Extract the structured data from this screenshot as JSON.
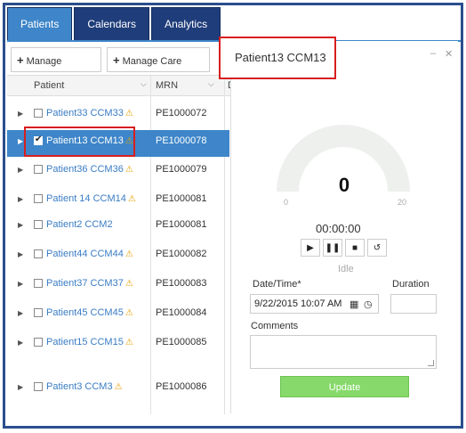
{
  "tabs": [
    {
      "label": "Patients",
      "active": true
    },
    {
      "label": "Calendars",
      "active": false
    },
    {
      "label": "Analytics",
      "active": false
    }
  ],
  "toolbar": {
    "manage_patients_label": "Manage Patients",
    "manage_care_team_label": "Manage Care Team"
  },
  "grid": {
    "headers": {
      "patient": "Patient",
      "mrn": "MRN",
      "third": "D"
    },
    "rows": [
      {
        "name": "Patient33 CCM33",
        "mrn": "PE1000072",
        "warn": true,
        "selected": false
      },
      {
        "name": "Patient13 CCM13",
        "mrn": "PE1000078",
        "warn": true,
        "selected": true
      },
      {
        "name": "Patient36 CCM36",
        "mrn": "PE1000079",
        "warn": true,
        "selected": false
      },
      {
        "name": "Patient 14 CCM14",
        "mrn": "PE1000081",
        "warn": true,
        "selected": false
      },
      {
        "name": "Patient2 CCM2",
        "mrn": "PE1000081",
        "warn": false,
        "selected": false
      },
      {
        "name": "Patient44 CCM44",
        "mrn": "PE1000082",
        "warn": true,
        "selected": false
      },
      {
        "name": "Patient37 CCM37",
        "mrn": "PE1000083",
        "warn": true,
        "selected": false
      },
      {
        "name": "Patient45 CCM45",
        "mrn": "PE1000084",
        "warn": true,
        "selected": false
      },
      {
        "name": "Patient15 CCM15",
        "mrn": "PE1000085",
        "warn": true,
        "selected": false
      },
      {
        "name": "Patient3 CCM3",
        "mrn": "PE1000086",
        "warn": true,
        "selected": false
      }
    ]
  },
  "panel": {
    "title": "Patient13 CCM13",
    "gauge_value": "0",
    "gauge_min": "0",
    "gauge_max": "20",
    "timer": "00:00:00",
    "status": "Idle",
    "datetime_label": "Date/Time*",
    "datetime_value": "9/22/2015 10:07 AM",
    "duration_label": "Duration",
    "comments_label": "Comments",
    "update_label": "Update"
  },
  "colors": {
    "tab_active": "#3e86c9",
    "tab_inactive": "#1f3d7a",
    "selection": "#3e86c9",
    "highlight": "#d81e1e",
    "update_button": "#86d96a"
  }
}
